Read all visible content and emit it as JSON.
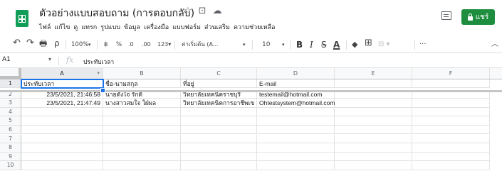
{
  "header": {
    "title": "ตัวอย่างแบบสอบถาม (การตอบกลับ)",
    "title_icons": [
      "☆",
      "⊡",
      "☁"
    ],
    "menu": [
      "ไฟล์",
      "แก้ไข",
      "ดู",
      "แทรก",
      "รูปแบบ",
      "ข้อมูล",
      "เครื่องมือ",
      "แบบฟอร์ม",
      "ส่วนเสริม",
      "ความช่วยเหลือ"
    ],
    "share_label": "แชร์",
    "brand_color": "#0f9d58",
    "share_color": "#1e8e3e"
  },
  "toolbar": {
    "undo": "↶",
    "redo": "↷",
    "print": "🖶",
    "paint_format": "⍴",
    "zoom": "100%",
    "zoom_caret": "▾",
    "currency": "฿",
    "percent": "%",
    "decrease_decimal": ".0",
    "increase_decimal": ".00",
    "more_formats": "123▾",
    "font": "ค่าเริ่มต้น (A...",
    "font_caret": "▾",
    "font_size": "10",
    "font_size_caret": "▾",
    "bold": "B",
    "italic": "I",
    "strike": "S",
    "text_color": "A",
    "fill_color": "◆",
    "borders": "⊞",
    "merge": "⊟ ▾",
    "more": "···",
    "collapse": "︿"
  },
  "formula_bar": {
    "name_box": "A1",
    "name_caret": "▾",
    "fx": "fx",
    "value": "ประทับเวลา"
  },
  "sheet": {
    "columns": [
      "A",
      "B",
      "C",
      "D",
      "E",
      "F"
    ],
    "row_numbers": [
      "1",
      "2",
      "3",
      "4",
      "5",
      "6",
      "7",
      "8",
      "9",
      "10"
    ],
    "rows": [
      [
        "ประทับเวลา",
        "ชื่อ-นามสกุล",
        "ที่อยู่",
        "E-mail",
        "",
        ""
      ],
      [
        "23/5/2021, 21:46:58",
        "นายตั้งใจ รักดี",
        "วิทยาลัยเทคนิคราชบุรี",
        "testemail@hotmail.com",
        "",
        ""
      ],
      [
        "23/5/2021, 21:47:49",
        "นางสาวสมใจ ใฝ่ผล",
        "วิทยาลัยเทคนิคการอาชีพเข",
        "Ohtestsystem@hotmail.com",
        "",
        ""
      ],
      [
        "",
        "",
        "",
        "",
        "",
        ""
      ],
      [
        "",
        "",
        "",
        "",
        "",
        ""
      ],
      [
        "",
        "",
        "",
        "",
        "",
        ""
      ],
      [
        "",
        "",
        "",
        "",
        "",
        ""
      ],
      [
        "",
        "",
        "",
        "",
        "",
        ""
      ],
      [
        "",
        "",
        "",
        "",
        "",
        ""
      ],
      [
        "",
        "",
        "",
        "",
        "",
        ""
      ]
    ],
    "active_cell": "A1",
    "selection_color": "#1a73e8"
  }
}
